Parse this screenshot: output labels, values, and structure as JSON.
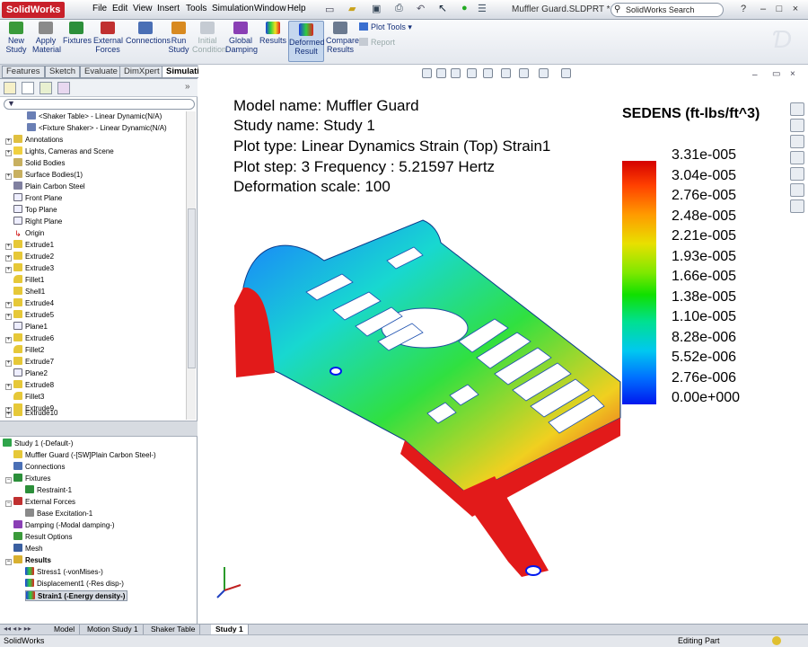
{
  "app": {
    "name": "SolidWorks",
    "doc_title": "Muffler Guard.SLDPRT *"
  },
  "menu": [
    "File",
    "Edit",
    "View",
    "Insert",
    "Tools",
    "Simulation",
    "Window",
    "Help"
  ],
  "search": {
    "placeholder": "SolidWorks Search"
  },
  "window_controls": [
    "?",
    "–",
    "□",
    "×"
  ],
  "commands": [
    {
      "label": "New Study",
      "icon": "new-study-icon",
      "enabled": true
    },
    {
      "label": "Apply Material",
      "icon": "material-icon",
      "enabled": true
    },
    {
      "label": "Fixtures",
      "icon": "fixture-icon",
      "enabled": true
    },
    {
      "label": "External Forces",
      "icon": "force-icon",
      "enabled": true
    },
    {
      "label": "Connections",
      "icon": "connections-icon",
      "enabled": true
    },
    {
      "label": "Run Study",
      "icon": "run-icon",
      "enabled": true
    },
    {
      "label": "Initial Condition",
      "icon": "initial-condition-icon",
      "enabled": false
    },
    {
      "label": "Global Damping",
      "icon": "damping-icon",
      "enabled": true
    },
    {
      "label": "Results",
      "icon": "results-icon",
      "enabled": true
    },
    {
      "label": "Deformed Result",
      "icon": "deformed-icon",
      "enabled": true
    },
    {
      "label": "Compare Results",
      "icon": "compare-icon",
      "enabled": true
    }
  ],
  "plot_tools": {
    "label": "Plot Tools",
    "report_label": "Report"
  },
  "cm_tabs": [
    "Features",
    "Sketch",
    "Evaluate",
    "DimXpert",
    "Simulation"
  ],
  "feature_tree": [
    "<Shaker Table> - Linear Dynamic(N/A)",
    "<Fixture Shaker> - Linear Dynamic(N/A)",
    "Annotations",
    "Lights, Cameras and Scene",
    "Solid Bodies",
    "Surface Bodies(1)",
    "Plain Carbon Steel",
    "Front Plane",
    "Top Plane",
    "Right Plane",
    "Origin",
    "Extrude1",
    "Extrude2",
    "Extrude3",
    "Fillet1",
    "Shell1",
    "Extrude4",
    "Extrude5",
    "Plane1",
    "Extrude6",
    "Fillet2",
    "Extrude7",
    "Plane2",
    "Extrude8",
    "Fillet3",
    "Extrude9",
    "Extrude10"
  ],
  "study_tree": [
    "Study 1 (-Default-)",
    "Muffler Guard (-[SW]Plain Carbon Steel-)",
    "Connections",
    "Fixtures",
    "Restraint-1",
    "External Forces",
    "Base Excitation-1",
    "Damping (-Modal damping-)",
    "Result Options",
    "Mesh",
    "Results",
    "Stress1 (-vonMises-)",
    "Displacement1 (-Res disp-)",
    "Strain1 (-Energy density-)"
  ],
  "plot_info": {
    "model": "Model name: Muffler Guard",
    "study": "Study name: Study 1",
    "plot_type": "Plot type: Linear Dynamics Strain (Top) Strain1",
    "plot_step": "Plot step: 3 Frequency : 5.21597 Hertz",
    "deformation": "Deformation scale: 100"
  },
  "legend": {
    "title": "SEDENS (ft-lbs/ft^3)",
    "values": [
      "3.31e-005",
      "3.04e-005",
      "2.76e-005",
      "2.48e-005",
      "2.21e-005",
      "1.93e-005",
      "1.66e-005",
      "1.38e-005",
      "1.10e-005",
      "8.28e-006",
      "5.52e-006",
      "2.76e-006",
      "0.00e+000"
    ]
  },
  "bottom_tabs": [
    "Model",
    "Motion Study 1",
    "Shaker Table",
    "Study 1"
  ],
  "status": {
    "left": "SolidWorks",
    "right": "Editing Part"
  },
  "colors": {
    "accent": "#c8202a",
    "selection": "#c5d7ee"
  }
}
